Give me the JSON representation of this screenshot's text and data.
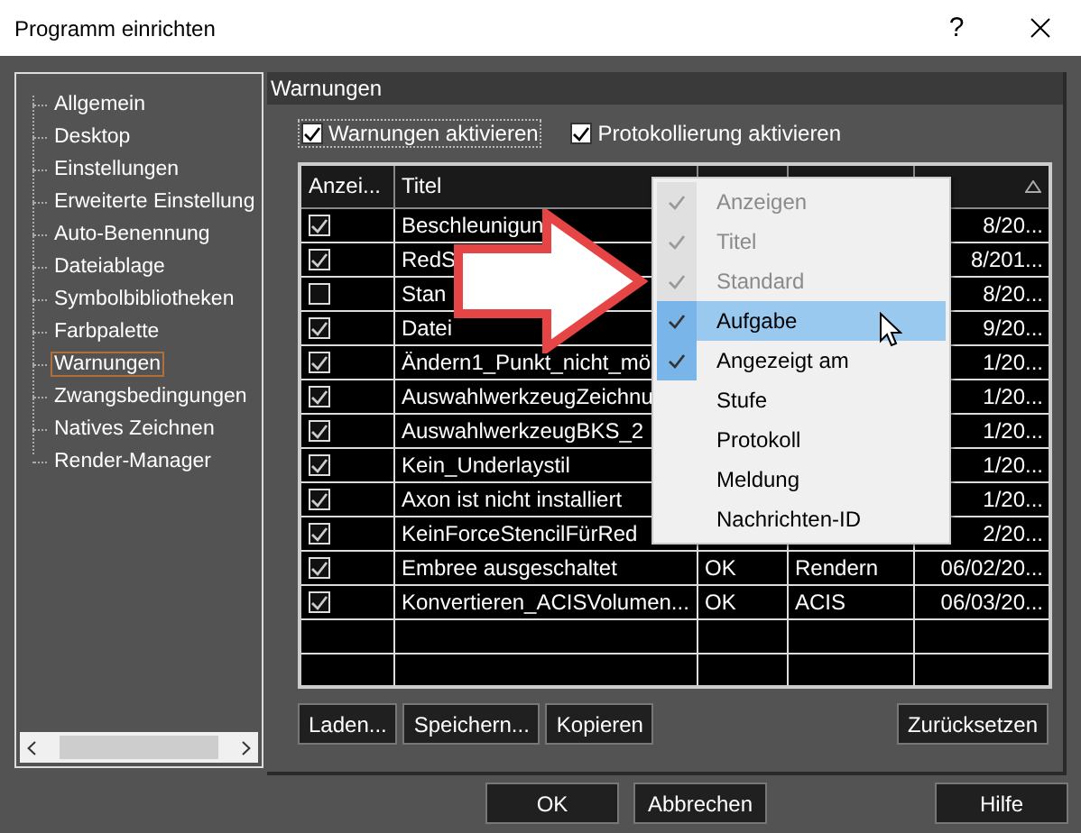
{
  "window": {
    "title": "Programm einrichten",
    "help": "?"
  },
  "sidebar": {
    "items": [
      {
        "label": "Allgemein",
        "selected": false
      },
      {
        "label": "Desktop",
        "selected": false
      },
      {
        "label": "Einstellungen",
        "selected": false
      },
      {
        "label": "Erweiterte Einstellung",
        "selected": false
      },
      {
        "label": "Auto-Benennung",
        "selected": false
      },
      {
        "label": "Dateiablage",
        "selected": false
      },
      {
        "label": "Symbolbibliotheken",
        "selected": false
      },
      {
        "label": "Farbpalette",
        "selected": false
      },
      {
        "label": "Warnungen",
        "selected": true
      },
      {
        "label": "Zwangsbedingungen",
        "selected": false
      },
      {
        "label": "Natives Zeichnen",
        "selected": false
      },
      {
        "label": "Render-Manager",
        "selected": false
      }
    ]
  },
  "panel": {
    "title": "Warnungen",
    "options": [
      {
        "label": "Warnungen aktivieren",
        "checked": true
      },
      {
        "label": "Protokollierung aktivieren",
        "checked": true
      }
    ],
    "table": {
      "columns": [
        {
          "label": "Anzei..."
        },
        {
          "label": "Titel"
        }
      ],
      "column_5_header": {
        "sorted": true
      },
      "rows": [
        {
          "show": true,
          "title": "Beschleunigun",
          "column_5": "8/20..."
        },
        {
          "show": true,
          "title": "RedS",
          "column_5": "8/201..."
        },
        {
          "show": false,
          "title": "Stan",
          "column_5": "8/20..."
        },
        {
          "show": true,
          "title": "Datei",
          "column_5": "9/20..."
        },
        {
          "show": true,
          "title": "Ändern1_Punkt_nicht_mö",
          "column_5": "1/20..."
        },
        {
          "show": true,
          "title": "AuswahlwerkzeugZeichnu",
          "column_5": "1/20..."
        },
        {
          "show": true,
          "title": "AuswahlwerkzeugBKS_2",
          "column_5": "1/20..."
        },
        {
          "show": true,
          "title": "Kein_Underlaystil",
          "column_5": "1/20..."
        },
        {
          "show": true,
          "title": "Axon ist nicht installiert",
          "column_5": "1/20..."
        },
        {
          "show": true,
          "title": "KeinForceStencilFürRed",
          "column_5": "2/20..."
        },
        {
          "show": true,
          "title": "Embree ausgeschaltet",
          "column_3": "OK",
          "column_4": "Rendern",
          "column_5": "06/02/20..."
        },
        {
          "show": true,
          "title": "Konvertieren_ACISVolumen...",
          "column_3": "OK",
          "column_4": "ACIS",
          "column_5": "06/03/20..."
        }
      ]
    },
    "buttons": [
      "Laden...",
      "Speichern...",
      "Kopieren",
      "Zurücksetzen"
    ]
  },
  "column_menu": [
    {
      "label": "Anzeigen",
      "checked": true,
      "disabled": true,
      "selected": false
    },
    {
      "label": "Titel",
      "checked": true,
      "disabled": true,
      "selected": false
    },
    {
      "label": "Standard",
      "checked": true,
      "disabled": true,
      "selected": false
    },
    {
      "label": "Aufgabe",
      "checked": true,
      "disabled": false,
      "selected": true
    },
    {
      "label": "Angezeigt am",
      "checked": true,
      "disabled": false,
      "selected": false
    },
    {
      "label": "Stufe",
      "checked": false,
      "disabled": false,
      "selected": false
    },
    {
      "label": "Protokoll",
      "checked": false,
      "disabled": false,
      "selected": false
    },
    {
      "label": "Meldung",
      "checked": false,
      "disabled": false,
      "selected": false
    },
    {
      "label": "Nachrichten-ID",
      "checked": false,
      "disabled": false,
      "selected": false
    }
  ],
  "footer_buttons": [
    "OK",
    "Abbrechen",
    "Hilfe"
  ]
}
